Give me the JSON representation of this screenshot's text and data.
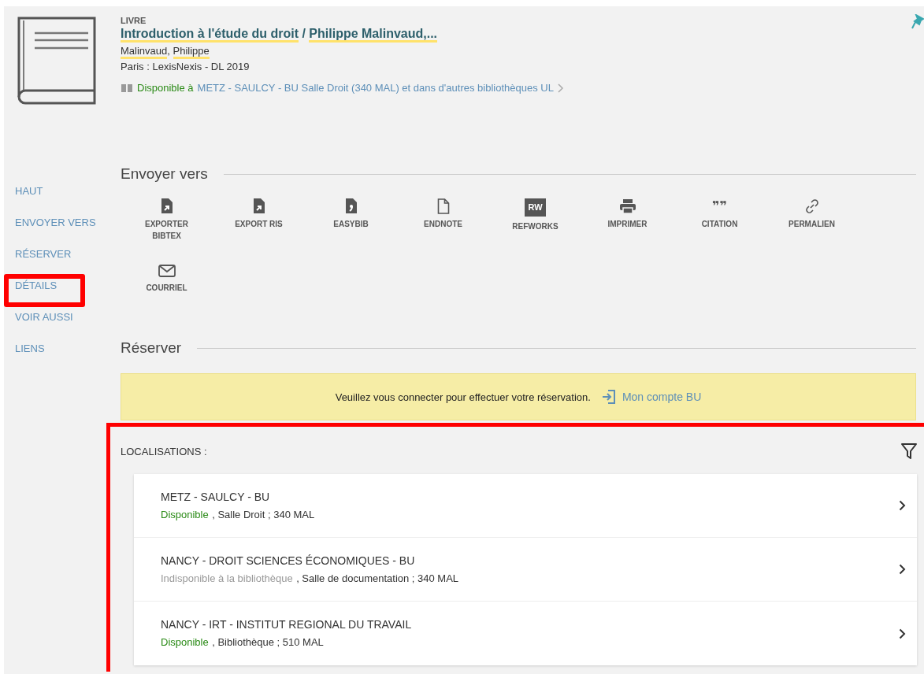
{
  "record": {
    "type": "LIVRE",
    "title_parts": [
      {
        "text": "Introduction à l'étude du droit",
        "highlighted": true
      },
      {
        "text": " / ",
        "highlighted": false
      },
      {
        "text": "Philippe Malinvaud,...",
        "highlighted": true
      }
    ],
    "author_parts": [
      {
        "text": "Malinvaud",
        "highlighted": true
      },
      {
        "text": ", ",
        "highlighted": false
      },
      {
        "text": "Philippe",
        "highlighted": true
      }
    ],
    "publication": "Paris : LexisNexis - DL 2019",
    "availability": {
      "status": "Disponible à",
      "location": "METZ - SAULCY - BU  Salle Droit (340 MAL) et dans d'autres bibliothèques UL"
    },
    "pinned": true
  },
  "sidebar": {
    "items": [
      {
        "label": "HAUT",
        "highlighted": false
      },
      {
        "label": "ENVOYER VERS",
        "highlighted": false
      },
      {
        "label": "RÉSERVER",
        "highlighted": false
      },
      {
        "label": "DÉTAILS",
        "highlighted": true
      },
      {
        "label": "VOIR AUSSI",
        "highlighted": false
      },
      {
        "label": "LIENS",
        "highlighted": false
      }
    ]
  },
  "send_to": {
    "heading": "Envoyer vers",
    "actions": [
      {
        "kind": "export",
        "label": "EXPORTER BIBTEX"
      },
      {
        "kind": "export",
        "label": "EXPORT RIS"
      },
      {
        "kind": "easybib",
        "label": "EASYBIB"
      },
      {
        "kind": "document",
        "label": "ENDNOTE"
      },
      {
        "kind": "refworks",
        "label": "REFWORKS",
        "badge": "RW"
      },
      {
        "kind": "print",
        "label": "IMPRIMER"
      },
      {
        "kind": "quote",
        "label": "CITATION",
        "glyph": "❞❞"
      },
      {
        "kind": "link",
        "label": "PERMALIEN"
      },
      {
        "kind": "mail",
        "label": "COURRIEL"
      }
    ]
  },
  "reserve": {
    "heading": "Réserver",
    "message": "Veuillez vous connecter pour effectuer votre réservation.",
    "login_link": "Mon compte BU"
  },
  "locations": {
    "heading": "LOCALISATIONS :",
    "highlighted": true,
    "items": [
      {
        "name": "METZ - SAULCY - BU",
        "status": "Disponible",
        "available": true,
        "details": ", Salle Droit ; 340 MAL"
      },
      {
        "name": "NANCY - DROIT SCIENCES ÉCONOMIQUES - BU",
        "status": "Indisponible à la bibliothèque",
        "available": false,
        "details": ", Salle de documentation ; 340 MAL"
      },
      {
        "name": "NANCY - IRT - INSTITUT REGIONAL DU TRAVAIL",
        "status": "Disponible",
        "available": true,
        "details": ", Bibliothèque ; 510 MAL"
      }
    ]
  }
}
